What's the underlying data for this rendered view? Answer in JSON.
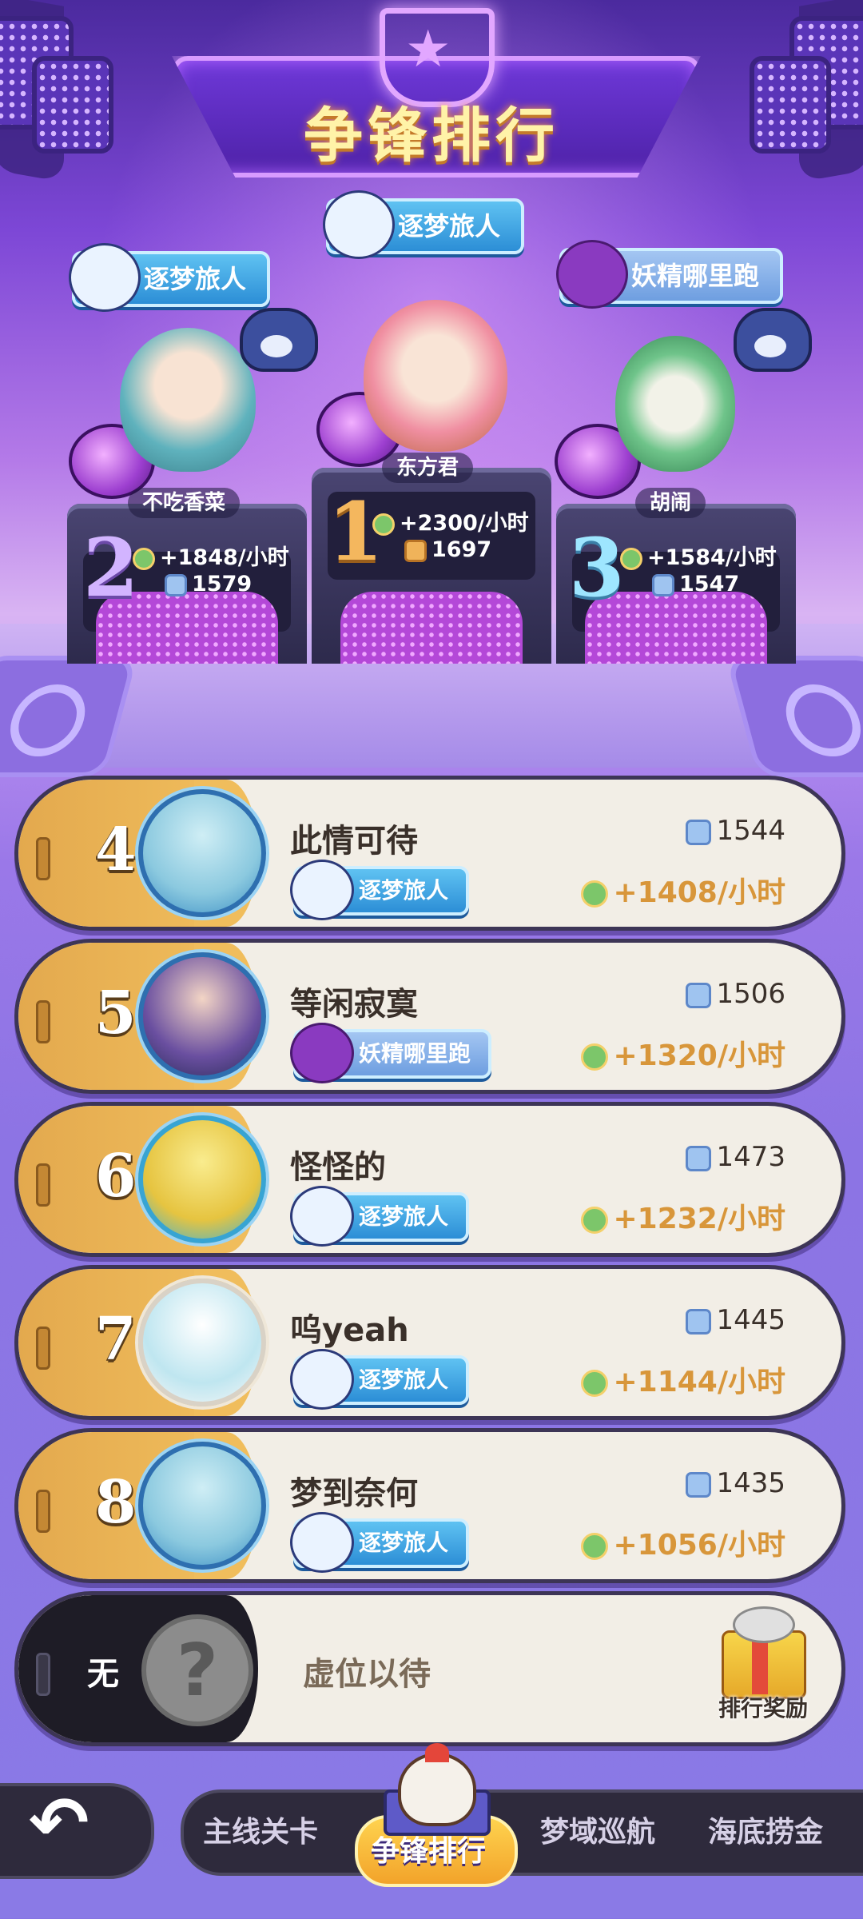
{
  "header": {
    "title": "争锋排行"
  },
  "podium": [
    {
      "rank": "1",
      "name": "东方君",
      "title": "逐梦旅人",
      "rate": "+2300/小时",
      "score": "1697"
    },
    {
      "rank": "2",
      "name": "不吃香菜",
      "title": "逐梦旅人",
      "rate": "+1848/小时",
      "score": "1579"
    },
    {
      "rank": "3",
      "name": "胡闹",
      "title": "妖精哪里跑",
      "rate": "+1584/小时",
      "score": "1547"
    }
  ],
  "ranking": [
    {
      "rank": "4",
      "name": "此情可待",
      "title": "逐梦旅人",
      "score": "1544",
      "rate": "+1408/小时"
    },
    {
      "rank": "5",
      "name": "等闲寂寞",
      "title": "妖精哪里跑",
      "score": "1506",
      "rate": "+1320/小时"
    },
    {
      "rank": "6",
      "name": "怪怪的",
      "title": "逐梦旅人",
      "score": "1473",
      "rate": "+1232/小时"
    },
    {
      "rank": "7",
      "name": "呜yeah",
      "title": "逐梦旅人",
      "score": "1445",
      "rate": "+1144/小时"
    },
    {
      "rank": "8",
      "name": "梦到奈何",
      "title": "逐梦旅人",
      "score": "1435",
      "rate": "+1056/小时"
    }
  ],
  "self_row": {
    "rank": "无",
    "avatar_placeholder": "?",
    "text": "虚位以待",
    "reward_label": "排行奖励"
  },
  "nav": {
    "back_icon": "back-arrow-icon",
    "tabs": [
      "主线关卡",
      "争锋排行",
      "梦域巡航",
      "海底捞金"
    ],
    "active_tab": "争锋排行"
  },
  "colors": {
    "accent": "#f0bd5c",
    "rate_text": "#d8963a",
    "title_gold": "#fff3a8",
    "panel_dark": "#2e2a3c"
  }
}
